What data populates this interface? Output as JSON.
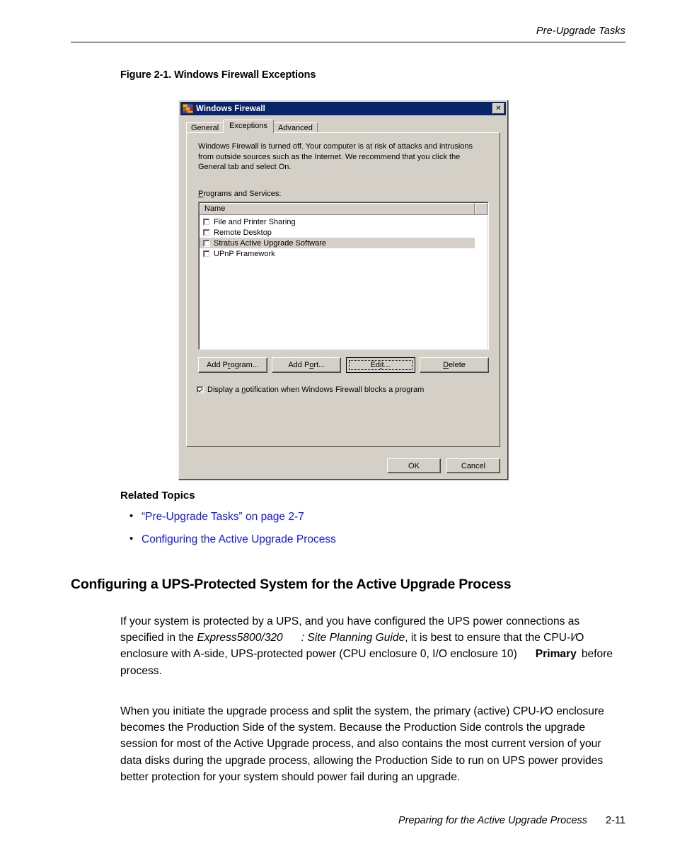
{
  "header": {
    "running_head": "Pre-Upgrade Tasks"
  },
  "figure": {
    "caption": "Figure 2-1. Windows Firewall Exceptions"
  },
  "dialog": {
    "title": "Windows Firewall",
    "icon": "windows-firewall-icon",
    "close_label": "✕",
    "tabs": [
      {
        "label": "General",
        "active": false
      },
      {
        "label": "Exceptions",
        "active": true
      },
      {
        "label": "Advanced",
        "active": false
      }
    ],
    "description": "Windows Firewall is turned off. Your computer is at risk of attacks and intrusions from outside sources such as the Internet. We recommend that you click the General tab and select On.",
    "group_label_prefix": "P",
    "group_label_rest": "rograms and Services:",
    "list": {
      "column_header": "Name",
      "rows": [
        {
          "label": "File and Printer Sharing",
          "checked": false,
          "selected": false
        },
        {
          "label": "Remote Desktop",
          "checked": false,
          "selected": false
        },
        {
          "label": "Stratus Active Upgrade Software",
          "checked": false,
          "selected": true
        },
        {
          "label": "UPnP Framework",
          "checked": false,
          "selected": false
        }
      ]
    },
    "action_buttons": [
      {
        "name": "add-program-button",
        "pre": "Add P",
        "accel": "r",
        "post": "ogram...",
        "default": false
      },
      {
        "name": "add-port-button",
        "pre": "Add P",
        "accel": "o",
        "post": "rt...",
        "default": false
      },
      {
        "name": "edit-button",
        "pre": "Ed",
        "accel": "i",
        "post": "t...",
        "default": true
      },
      {
        "name": "delete-button",
        "pre": "",
        "accel": "D",
        "post": "elete",
        "default": false
      }
    ],
    "notification": {
      "checked": true,
      "pre": "Display a ",
      "accel": "n",
      "post": "otification when Windows Firewall blocks a program"
    },
    "footer_buttons": [
      {
        "name": "ok-button",
        "label": "OK"
      },
      {
        "name": "cancel-button",
        "label": "Cancel"
      }
    ]
  },
  "related_topics": {
    "heading": "Related Topics",
    "links": [
      "“Pre-Upgrade Tasks” on page 2-7",
      "Configuring the Active Upgrade Process"
    ],
    "link_color": "#1414ff"
  },
  "section": {
    "heading": "Configuring a UPS-Protected System for the Active Upgrade Process",
    "paragraph_1": {
      "part_1": "If your system is protected by a UPS, and you have configured the UPS power connections as specified in the ",
      "italic_1": "Express5800/320",
      "italic_2": ": Site Planning Guide",
      "part_2": ", it is best to ensure that the CPU-I∕O enclosure with A-side, UPS-protected power (CPU enclosure 0, I/O enclosure 10)",
      "bold_1": "Primary",
      "part_3": "before",
      "part_4": "process."
    },
    "paragraph_2": "When you initiate the upgrade process and split the system, the primary (active) CPU-I∕O enclosure becomes the Production Side of the system. Because the Production Side controls the upgrade session for most of the Active Upgrade process, and also contains the most current version of your data disks during the upgrade process, allowing the Production Side to run on UPS power provides better protection for your system should power fail during an upgrade."
  },
  "footer": {
    "title": "Preparing for the Active Upgrade Process",
    "page_number": "2-11"
  }
}
